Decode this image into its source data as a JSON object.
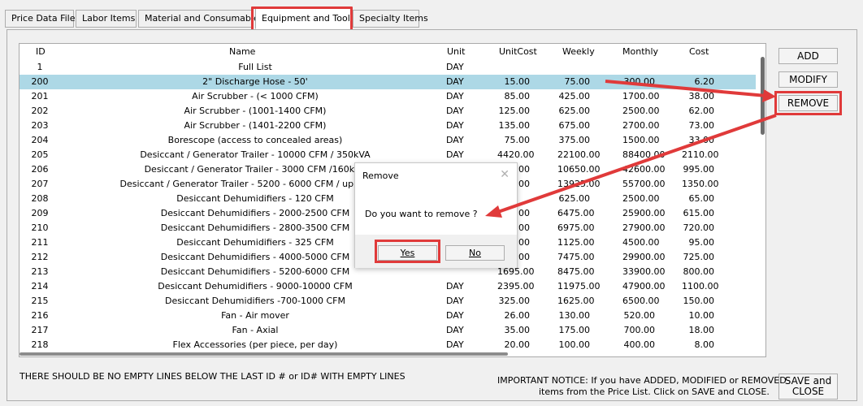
{
  "tabs": [
    {
      "label": "Price Data File"
    },
    {
      "label": "Labor Items"
    },
    {
      "label": "Material and Consumable"
    },
    {
      "label": "Equipment and Tools"
    },
    {
      "label": "Specialty Items"
    }
  ],
  "active_tab": "Equipment and Tools",
  "grid": {
    "headers": {
      "id": "ID",
      "name": "Name",
      "unit": "Unit",
      "unitcost": "UnitCost",
      "weekly": "Weekly",
      "monthly": "Monthly",
      "cost": "Cost"
    },
    "selected_id": "200",
    "rows": [
      {
        "id": "1",
        "name": "Full List",
        "unit": "DAY",
        "unitcost": "",
        "weekly": "",
        "monthly": "",
        "cost": ""
      },
      {
        "id": "200",
        "name": "2\" Discharge Hose - 50'",
        "unit": "DAY",
        "unitcost": "15.00",
        "weekly": "75.00",
        "monthly": "300.00",
        "cost": "6.20"
      },
      {
        "id": "201",
        "name": "Air Scrubber - (< 1000 CFM)",
        "unit": "DAY",
        "unitcost": "85.00",
        "weekly": "425.00",
        "monthly": "1700.00",
        "cost": "38.00"
      },
      {
        "id": "202",
        "name": "Air Scrubber - (1001-1400 CFM)",
        "unit": "DAY",
        "unitcost": "125.00",
        "weekly": "625.00",
        "monthly": "2500.00",
        "cost": "62.00"
      },
      {
        "id": "203",
        "name": "Air Scrubber - (1401-2200 CFM)",
        "unit": "DAY",
        "unitcost": "135.00",
        "weekly": "675.00",
        "monthly": "2700.00",
        "cost": "73.00"
      },
      {
        "id": "204",
        "name": "Borescope (access to concealed areas)",
        "unit": "DAY",
        "unitcost": "75.00",
        "weekly": "375.00",
        "monthly": "1500.00",
        "cost": "33.00"
      },
      {
        "id": "205",
        "name": "Desiccant / Generator Trailer - 10000 CFM / 350kVA",
        "unit": "DAY",
        "unitcost": "4420.00",
        "weekly": "22100.00",
        "monthly": "88400.00",
        "cost": "2110.00"
      },
      {
        "id": "206",
        "name": "Desiccant / Generator Trailer - 3000 CFM /160kVA",
        "unit": "",
        "unitcost": ".00",
        "weekly": "10650.00",
        "monthly": "42600.00",
        "cost": "995.00"
      },
      {
        "id": "207",
        "name": "Desiccant / Generator Trailer - 5200 - 6000 CFM / up to 125k",
        "unit": "",
        "unitcost": ".00",
        "weekly": "13925.00",
        "monthly": "55700.00",
        "cost": "1350.00"
      },
      {
        "id": "208",
        "name": "Desiccant Dehumidifiers - 120 CFM",
        "unit": "",
        "unitcost": "",
        "weekly": "625.00",
        "monthly": "2500.00",
        "cost": "65.00"
      },
      {
        "id": "209",
        "name": "Desiccant Dehumidifiers - 2000-2500 CFM",
        "unit": "",
        "unitcost": ".00",
        "weekly": "6475.00",
        "monthly": "25900.00",
        "cost": "615.00"
      },
      {
        "id": "210",
        "name": "Desiccant Dehumidifiers - 2800-3500 CFM",
        "unit": "",
        "unitcost": ".00",
        "weekly": "6975.00",
        "monthly": "27900.00",
        "cost": "720.00"
      },
      {
        "id": "211",
        "name": "Desiccant Dehumidifiers - 325 CFM",
        "unit": "",
        "unitcost": ".00",
        "weekly": "1125.00",
        "monthly": "4500.00",
        "cost": "95.00"
      },
      {
        "id": "212",
        "name": "Desiccant Dehumidifiers - 4000-5000 CFM",
        "unit": "",
        "unitcost": ".00",
        "weekly": "7475.00",
        "monthly": "29900.00",
        "cost": "725.00"
      },
      {
        "id": "213",
        "name": "Desiccant Dehumidifiers - 5200-6000 CFM",
        "unit": "",
        "unitcost": "1695.00",
        "weekly": "8475.00",
        "monthly": "33900.00",
        "cost": "800.00"
      },
      {
        "id": "214",
        "name": "Desiccant Dehumidifiers - 9000-10000 CFM",
        "unit": "DAY",
        "unitcost": "2395.00",
        "weekly": "11975.00",
        "monthly": "47900.00",
        "cost": "1100.00"
      },
      {
        "id": "215",
        "name": "Desiccant Dehumidifiers -700-1000 CFM",
        "unit": "DAY",
        "unitcost": "325.00",
        "weekly": "1625.00",
        "monthly": "6500.00",
        "cost": "150.00"
      },
      {
        "id": "216",
        "name": "Fan - Air mover",
        "unit": "DAY",
        "unitcost": "26.00",
        "weekly": "130.00",
        "monthly": "520.00",
        "cost": "10.00"
      },
      {
        "id": "217",
        "name": "Fan - Axial",
        "unit": "DAY",
        "unitcost": "35.00",
        "weekly": "175.00",
        "monthly": "700.00",
        "cost": "18.00"
      },
      {
        "id": "218",
        "name": "Flex Accessories (per piece, per day)",
        "unit": "DAY",
        "unitcost": "20.00",
        "weekly": "100.00",
        "monthly": "400.00",
        "cost": "8.00"
      }
    ]
  },
  "buttons": {
    "add": "ADD",
    "modify": "MODIFY",
    "remove": "REMOVE",
    "save_close_1": "SAVE and",
    "save_close_2": "CLOSE"
  },
  "notice_left": "THERE SHOULD BE NO EMPTY LINES BELOW THE LAST ID # or ID# WITH EMPTY LINES",
  "notice_right_1": "IMPORTANT NOTICE:  If you have ADDED, MODIFIED or REMOVED",
  "notice_right_2": "items from the Price List.  Click on SAVE and CLOSE.",
  "dialog": {
    "title": "Remove",
    "close": "✕",
    "message": "Do you want to remove ?",
    "yes": "Yes",
    "no": "No"
  },
  "colors": {
    "highlight": "#e03a3a",
    "selection": "#add8e6"
  }
}
